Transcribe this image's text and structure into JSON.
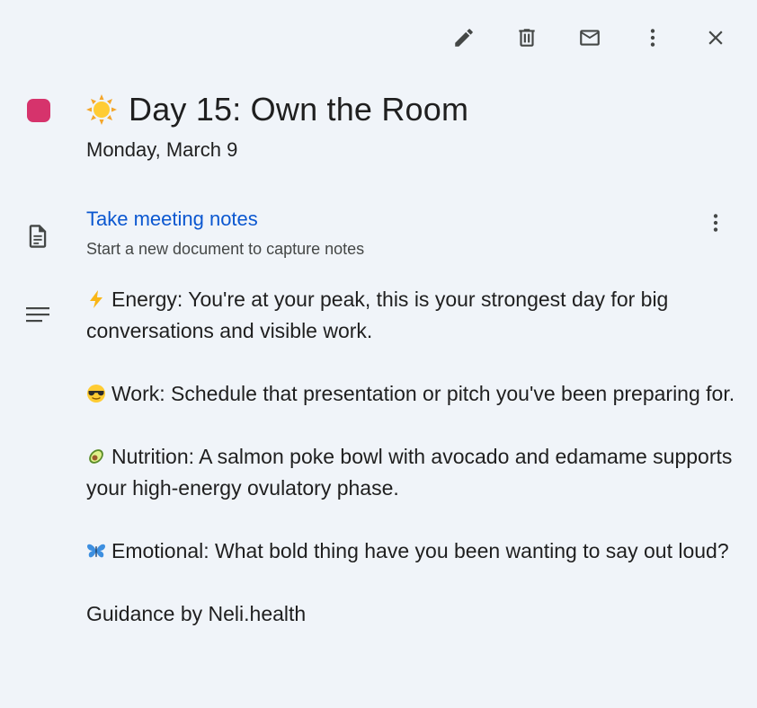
{
  "toolbar": {
    "edit_icon": "pencil-icon",
    "delete_icon": "trash-icon",
    "email_icon": "mail-icon",
    "more_icon": "more-vert-icon",
    "close_icon": "close-icon"
  },
  "event": {
    "color": "#d6336c",
    "title_icon": "sun-icon",
    "title": "Day 15: Own the Room",
    "date": "Monday, March 9"
  },
  "notes": {
    "icon": "document-icon",
    "link_label": "Take meeting notes",
    "subtitle": "Start a new document to capture notes",
    "more_icon": "more-vert-icon"
  },
  "description": {
    "icon": "notes-lines-icon",
    "paragraphs": [
      {
        "emoji": "lightning-icon",
        "text": "Energy: You're at your peak, this is your strongest day for big conversations and visible work."
      },
      {
        "emoji": "sunglasses-face-icon",
        "text": "Work: Schedule that presentation or pitch you've been preparing for."
      },
      {
        "emoji": "avocado-icon",
        "text": "Nutrition: A salmon poke bowl with avocado and edamame supports your high-energy ovulatory phase."
      },
      {
        "emoji": "butterfly-icon",
        "text": "Emotional: What bold thing have you been wanting to say out loud?"
      },
      {
        "emoji": "",
        "text": "Guidance by Neli.health"
      }
    ]
  }
}
